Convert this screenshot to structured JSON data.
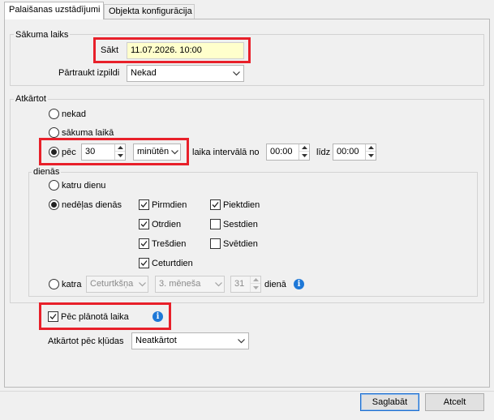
{
  "tabs": [
    {
      "label": "Palaišanas uzstādījumi",
      "active": true
    },
    {
      "label": "Objekta konfigurācija",
      "active": false
    }
  ],
  "start_group": {
    "title": "Sākuma laiks",
    "start_label": "Sākt",
    "start_value": "11.07.2026. 10:00",
    "stop_label": "Pārtraukt izpildi",
    "stop_value": "Nekad"
  },
  "repeat_group": {
    "title": "Atkārtot",
    "options": {
      "never": "nekad",
      "at_start": "sākuma laikā",
      "every": "pēc"
    },
    "selected": "every",
    "every_value": "30",
    "unit_value": "minūtēn",
    "interval_label": "laika intervālā no",
    "from_time": "00:00",
    "until_label": "līdz",
    "until_time": "00:00"
  },
  "days_group": {
    "title": "dienās",
    "every_day_label": "katru dienu",
    "weekdays_label": "nedēļas dienās",
    "selected": "weekdays",
    "days": [
      {
        "label": "Pirmdien",
        "checked": true
      },
      {
        "label": "Otrdien",
        "checked": true
      },
      {
        "label": "Trešdien",
        "checked": true
      },
      {
        "label": "Ceturtdien",
        "checked": true
      },
      {
        "label": "Piektdien",
        "checked": true
      },
      {
        "label": "Sestdien",
        "checked": false
      },
      {
        "label": "Svētdien",
        "checked": false
      }
    ],
    "every_label": "katra",
    "weekday_select": "Ceturtkšņa",
    "month_select": "3. mēneša",
    "day_number": "31",
    "day_suffix": "dienā"
  },
  "after_planned": {
    "label": "Pēc plānotā laika",
    "checked": true
  },
  "retry": {
    "label": "Atkārtot pēc kļūdas",
    "value": "Neatkārtot"
  },
  "buttons": {
    "save": "Saglabāt",
    "cancel": "Atcelt"
  },
  "colors": {
    "highlight": "#e8202a",
    "info": "#1e78d7",
    "start_field_bg": "#ffffcc"
  }
}
